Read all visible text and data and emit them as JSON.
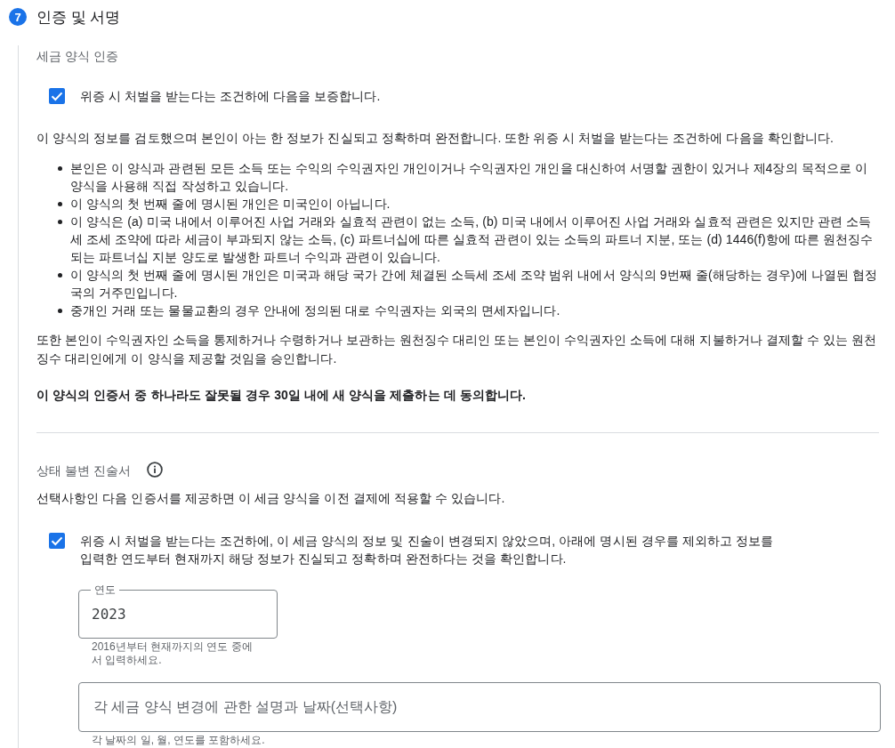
{
  "section": {
    "number": "7",
    "title": "인증 및 서명"
  },
  "certification": {
    "heading": "세금 양식 인증",
    "checkbox": {
      "label": "위증 시 처벌을 받는다는 조건하에 다음을 보증합니다.",
      "checked": true
    },
    "intro": "이 양식의 정보를 검토했으며 본인이 아는 한 정보가 진실되고 정확하며 완전합니다. 또한 위증 시 처벌을 받는다는 조건하에 다음을 확인합니다.",
    "bullets": [
      "본인은 이 양식과 관련된 모든 소득 또는 수익의 수익권자인 개인이거나 수익권자인 개인을 대신하여 서명할 권한이 있거나 제4장의 목적으로 이 양식을 사용해 직접 작성하고 있습니다.",
      "이 양식의 첫 번째 줄에 명시된 개인은 미국인이 아닙니다.",
      "이 양식은 (a) 미국 내에서 이루어진 사업 거래와 실효적 관련이 없는 소득, (b) 미국 내에서 이루어진 사업 거래와 실효적 관련은 있지만 관련 소득세 조세 조약에 따라 세금이 부과되지 않는 소득, (c) 파트너십에 따른 실효적 관련이 있는 소득의 파트너 지분, 또는 (d) 1446(f)항에 따른 원천징수되는 파트너십 지분 양도로 발생한 파트너 수익과 관련이 있습니다.",
      "이 양식의 첫 번째 줄에 명시된 개인은 미국과 해당 국가 간에 체결된 소득세 조세 조약 범위 내에서 양식의 9번째 줄(해당하는 경우)에 나열된 협정국의 거주민입니다.",
      "중개인 거래 또는 물물교환의 경우 안내에 정의된 대로 수익권자는 외국의 면세자입니다."
    ],
    "paragraph": "또한 본인이 수익권자인 소득을 통제하거나 수령하거나 보관하는 원천징수 대리인 또는 본인이 수익권자인 소득에 대해 지불하거나 결제할 수 있는 원천징수 대리인에게 이 양식을 제공할 것임을 승인합니다.",
    "agreement": "이 양식의 인증서 중 하나라도 잘못될 경우 30일 내에 새 양식을 제출하는 데 동의합니다."
  },
  "change_statement": {
    "heading": "상태 불변 진술서",
    "description": "선택사항인 다음 인증서를 제공하면 이 세금 양식을 이전 결제에 적용할 수 있습니다.",
    "checkbox": {
      "label": "위증 시 처벌을 받는다는 조건하에, 이 세금 양식의 정보 및 진술이 변경되지 않았으며, 아래에 명시된 경우를 제외하고 정보를 입력한 연도부터 현재까지 해당 정보가 진실되고 정확하며 완전하다는 것을 확인합니다.",
      "checked": true
    },
    "year_field": {
      "label": "연도",
      "value": "2023",
      "helper": "2016년부터 현재까지의 연도 중에서 입력하세요."
    },
    "changes_field": {
      "placeholder": "각 세금 양식 변경에 관한 설명과 날짜(선택사항)",
      "helper": "각 날짜의 일, 월, 연도를 포함하세요."
    }
  }
}
